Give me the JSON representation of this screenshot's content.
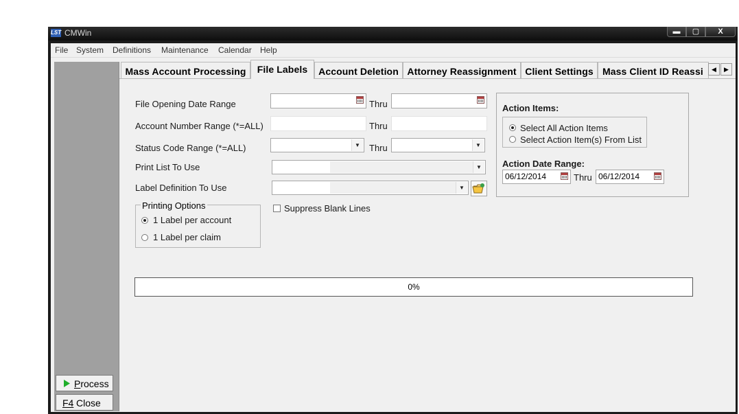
{
  "window": {
    "title": "CMWin",
    "logo_text": "LST",
    "minimize_label": "▬",
    "maximize_label": "▢",
    "close_label": "X"
  },
  "menu": [
    "File",
    "System",
    "Definitions",
    "Maintenance",
    "Calendar",
    "Help"
  ],
  "tabs": [
    {
      "label": "Mass Account Processing",
      "active": false
    },
    {
      "label": "File Labels",
      "active": true
    },
    {
      "label": "Account Deletion",
      "active": false
    },
    {
      "label": "Attorney Reassignment",
      "active": false
    },
    {
      "label": "Client Settings",
      "active": false
    },
    {
      "label": "Mass Client ID Reassi",
      "active": false
    }
  ],
  "form": {
    "file_opening": {
      "label": "File Opening Date Range",
      "thru": "Thru",
      "from_value": "",
      "to_value": ""
    },
    "account_number": {
      "label": "Account Number Range (*=ALL)",
      "thru": "Thru",
      "from_value": "",
      "to_value": ""
    },
    "status_code": {
      "label": "Status Code Range (*=ALL)",
      "thru": "Thru",
      "from_value": "",
      "to_value": ""
    },
    "print_list": {
      "label": "Print List To Use",
      "value": ""
    },
    "label_definition": {
      "label": "Label Definition To Use",
      "value": ""
    },
    "suppress_blank_lines": {
      "label": "Suppress Blank Lines",
      "checked": false
    },
    "printing_options": {
      "legend": "Printing Options",
      "options": [
        {
          "label": "1 Label per account",
          "selected": true
        },
        {
          "label": "1 Label per claim",
          "selected": false
        }
      ]
    }
  },
  "action_items": {
    "heading": "Action Items:",
    "options": [
      {
        "label": "Select All Action Items",
        "selected": true
      },
      {
        "label": "Select Action Item(s) From List",
        "selected": false
      }
    ],
    "date_range_heading": "Action Date Range:",
    "from_date": "06/12/2014",
    "thru": "Thru",
    "to_date": "06/12/2014"
  },
  "progress": {
    "value": 0,
    "text": "0%"
  },
  "buttons": {
    "process_accel": "P",
    "process_rest": "rocess",
    "close_key": "F4",
    "close_label": "Close"
  },
  "colors": {
    "accent": "#2f5fb3",
    "panel_gray": "#a0a0a0",
    "surface": "#f0f0f0"
  }
}
